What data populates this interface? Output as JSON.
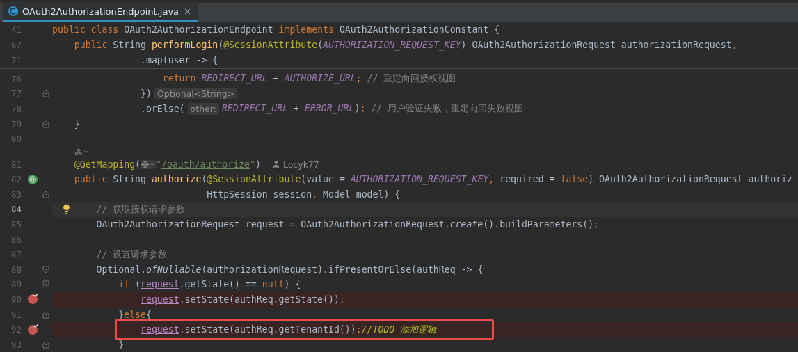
{
  "tab": {
    "title": "OAuth2AuthorizationEndpoint.java",
    "selected": true
  },
  "sticky_lines": [
    {
      "number": "41",
      "tokens": [
        {
          "text": "public class ",
          "kind": "kw"
        },
        {
          "text": "OAuth2AuthorizationEndpoint ",
          "kind": "p"
        },
        {
          "text": "implements ",
          "kind": "kw"
        },
        {
          "text": "OAuth2AuthorizationConstant {",
          "kind": "p"
        }
      ]
    },
    {
      "number": "67",
      "tokens": [
        {
          "text": "    public ",
          "kind": "kw"
        },
        {
          "text": "String ",
          "kind": "p"
        },
        {
          "text": "performLogin",
          "kind": "fn"
        },
        {
          "text": "(",
          "kind": "p"
        },
        {
          "text": "@SessionAttribute",
          "kind": "ann"
        },
        {
          "text": "(",
          "kind": "p"
        },
        {
          "text": "AUTHORIZATION_REQUEST_KEY",
          "kind": "const"
        },
        {
          "text": ") OAuth2AuthorizationRequest authorizationRequest",
          "kind": "p"
        },
        {
          "text": ",",
          "kind": "kw"
        }
      ]
    },
    {
      "number": "71",
      "tokens": [
        {
          "text": "                .map(user -> {",
          "kind": "p"
        }
      ]
    }
  ],
  "lines": [
    {
      "kind": "code",
      "number": "76",
      "breakpoint": false,
      "current": false,
      "segments": [
        {
          "kind": "code",
          "tokens": [
            {
              "text": "                    return ",
              "kind": "kw"
            },
            {
              "text": "REDIRECT_URL",
              "kind": "const"
            },
            {
              "text": " + ",
              "kind": "p"
            },
            {
              "text": "AUTHORIZE_URL",
              "kind": "const"
            },
            {
              "text": ";",
              "kind": "kw"
            },
            {
              "text": " // 重定向回授权视图",
              "kind": "cm"
            }
          ]
        }
      ]
    },
    {
      "kind": "code",
      "number": "77",
      "breakpoint": false,
      "current": false,
      "fold_end": true,
      "segments": [
        {
          "kind": "code",
          "tokens": [
            {
              "text": "                })",
              "kind": "p"
            }
          ]
        },
        {
          "kind": "hint",
          "text": "Optional<String>"
        }
      ]
    },
    {
      "kind": "code",
      "number": "78",
      "breakpoint": false,
      "current": false,
      "segments": [
        {
          "kind": "code",
          "tokens": [
            {
              "text": "                .orElse(",
              "kind": "p"
            }
          ]
        },
        {
          "kind": "hint",
          "text": "other:"
        },
        {
          "kind": "code",
          "tokens": [
            {
              "text": "REDIRECT_URL",
              "kind": "const"
            },
            {
              "text": " + ",
              "kind": "p"
            },
            {
              "text": "ERROR_URL",
              "kind": "const"
            },
            {
              "text": ")",
              "kind": "p"
            },
            {
              "text": ";",
              "kind": "kw"
            },
            {
              "text": " // 用户验证失败，重定向回失败视图",
              "kind": "cm"
            }
          ]
        }
      ]
    },
    {
      "kind": "code",
      "number": "79",
      "breakpoint": false,
      "current": false,
      "fold_end": true,
      "segments": [
        {
          "kind": "code",
          "tokens": [
            {
              "text": "    }",
              "kind": "p"
            }
          ]
        }
      ]
    },
    {
      "kind": "code",
      "number": "80",
      "breakpoint": false,
      "current": false
    },
    {
      "kind": "vision"
    },
    {
      "kind": "code",
      "number": "81",
      "breakpoint": false,
      "current": false,
      "segments": [
        {
          "kind": "code",
          "tokens": [
            {
              "text": "    @GetMapping",
              "kind": "ann"
            },
            {
              "text": "(",
              "kind": "p"
            }
          ]
        },
        {
          "kind": "globe"
        },
        {
          "kind": "code",
          "tokens": [
            {
              "text": "\"",
              "kind": "str"
            },
            {
              "text": "/oauth/authorize",
              "kind": "link"
            },
            {
              "text": "\"",
              "kind": "str"
            },
            {
              "text": ")",
              "kind": "p"
            }
          ]
        },
        {
          "kind": "author",
          "text": "Locyk77"
        }
      ]
    },
    {
      "kind": "code",
      "number": "82",
      "breakpoint": false,
      "current": false,
      "endpoint": true,
      "segments": [
        {
          "kind": "code",
          "tokens": [
            {
              "text": "    public ",
              "kind": "kw"
            },
            {
              "text": "String ",
              "kind": "p"
            },
            {
              "text": "authorize",
              "kind": "fn"
            },
            {
              "text": "(",
              "kind": "p"
            },
            {
              "text": "@SessionAttribute",
              "kind": "ann"
            },
            {
              "text": "(value = ",
              "kind": "p"
            },
            {
              "text": "AUTHORIZATION_REQUEST_KEY",
              "kind": "const"
            },
            {
              "text": ", ",
              "kind": "kw"
            },
            {
              "text": "required = ",
              "kind": "p"
            },
            {
              "text": "false",
              "kind": "kw"
            },
            {
              "text": ") OAuth2AuthorizationRequest authoriz",
              "kind": "p"
            }
          ]
        }
      ]
    },
    {
      "kind": "code",
      "number": "83",
      "breakpoint": false,
      "current": false,
      "fold_end": true,
      "segments": [
        {
          "kind": "code",
          "tokens": [
            {
              "text": "                            HttpSession session",
              "kind": "p"
            },
            {
              "text": ", ",
              "kind": "kw"
            },
            {
              "text": "Model model) {",
              "kind": "p"
            }
          ]
        }
      ]
    },
    {
      "kind": "code",
      "number": "84",
      "breakpoint": false,
      "current": true,
      "bulb": true,
      "segments": [
        {
          "kind": "code",
          "tokens": [
            {
              "text": "        // 获取授权请求参数",
              "kind": "cm"
            }
          ]
        }
      ]
    },
    {
      "kind": "code",
      "number": "85",
      "breakpoint": false,
      "current": false,
      "segments": [
        {
          "kind": "code",
          "tokens": [
            {
              "text": "        OAuth2AuthorizationRequest request = OAuth2AuthorizationRequest.",
              "kind": "p"
            },
            {
              "text": "create",
              "kind": "it"
            },
            {
              "text": "().buildParameters()",
              "kind": "p"
            },
            {
              "text": ";",
              "kind": "kw"
            }
          ]
        }
      ]
    },
    {
      "kind": "code",
      "number": "86",
      "breakpoint": false,
      "current": false
    },
    {
      "kind": "code",
      "number": "87",
      "breakpoint": false,
      "current": false,
      "segments": [
        {
          "kind": "code",
          "tokens": [
            {
              "text": "        // 设置请求参数",
              "kind": "cm"
            }
          ]
        }
      ]
    },
    {
      "kind": "code",
      "number": "88",
      "breakpoint": false,
      "current": false,
      "fold_start": true,
      "segments": [
        {
          "kind": "code",
          "tokens": [
            {
              "text": "        Optional.",
              "kind": "p"
            },
            {
              "text": "ofNullable",
              "kind": "it"
            },
            {
              "text": "(authorizationRequest).ifPresentOrElse(authReq -> {",
              "kind": "p"
            }
          ]
        }
      ]
    },
    {
      "kind": "code",
      "number": "89",
      "breakpoint": false,
      "current": false,
      "fold_start": true,
      "segments": [
        {
          "kind": "code",
          "tokens": [
            {
              "text": "            if ",
              "kind": "kw"
            },
            {
              "text": "(",
              "kind": "p"
            },
            {
              "text": "request",
              "kind": "field"
            },
            {
              "text": ".getState() == ",
              "kind": "p"
            },
            {
              "text": "null",
              "kind": "kw"
            },
            {
              "text": ") {",
              "kind": "p"
            }
          ]
        }
      ]
    },
    {
      "kind": "code",
      "number": "90",
      "breakpoint": true,
      "current": false,
      "segments": [
        {
          "kind": "code",
          "tokens": [
            {
              "text": "                request",
              "kind": "field"
            },
            {
              "text": ".setState(authReq.getState())",
              "kind": "p"
            },
            {
              "text": ";",
              "kind": "kw"
            }
          ]
        }
      ]
    },
    {
      "kind": "code",
      "number": "91",
      "breakpoint": false,
      "current": false,
      "fold_end": true,
      "segments": [
        {
          "kind": "code",
          "tokens": [
            {
              "text": "            }",
              "kind": "p"
            },
            {
              "text": "else",
              "kind": "kw"
            },
            {
              "text": "{",
              "kind": "p"
            }
          ]
        }
      ]
    },
    {
      "kind": "code",
      "number": "92",
      "breakpoint": true,
      "current": false,
      "highlighted": true,
      "segments": [
        {
          "kind": "code",
          "tokens": [
            {
              "text": "                request",
              "kind": "field"
            },
            {
              "text": ".setState(authReq.getTenantId())",
              "kind": "p"
            },
            {
              "text": ";",
              "kind": "kw"
            },
            {
              "text": "//TODO 添加逻辑",
              "kind": "todo"
            }
          ]
        }
      ]
    },
    {
      "kind": "code",
      "number": "93",
      "breakpoint": false,
      "current": false,
      "fold_end": true,
      "segments": [
        {
          "kind": "code",
          "tokens": [
            {
              "text": "            }",
              "kind": "p"
            }
          ]
        }
      ]
    }
  ]
}
